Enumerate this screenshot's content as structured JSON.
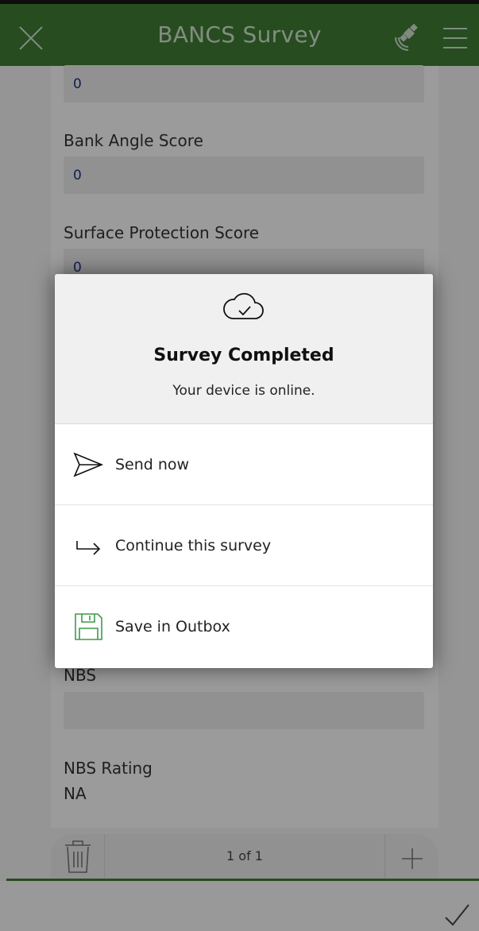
{
  "header": {
    "title": "BANCS Survey"
  },
  "form": {
    "fields": [
      {
        "label": "",
        "value": "0"
      },
      {
        "label": "Bank Angle Score",
        "value": "0"
      },
      {
        "label": "Surface Protection Score",
        "value": "0"
      },
      {
        "label": "NBS",
        "value": ""
      }
    ],
    "nbs_rating": {
      "label": "NBS Rating",
      "value": "NA"
    }
  },
  "pager": {
    "text": "1 of 1"
  },
  "dialog": {
    "title": "Survey Completed",
    "subtitle": "Your device is online.",
    "actions": [
      {
        "label": "Send now",
        "icon": "send-icon"
      },
      {
        "label": "Continue this survey",
        "icon": "continue-arrow-icon"
      },
      {
        "label": "Save in Outbox",
        "icon": "save-icon"
      }
    ]
  },
  "colors": {
    "header_bg": "#3e7b33",
    "save_icon": "#3e9a4a"
  }
}
